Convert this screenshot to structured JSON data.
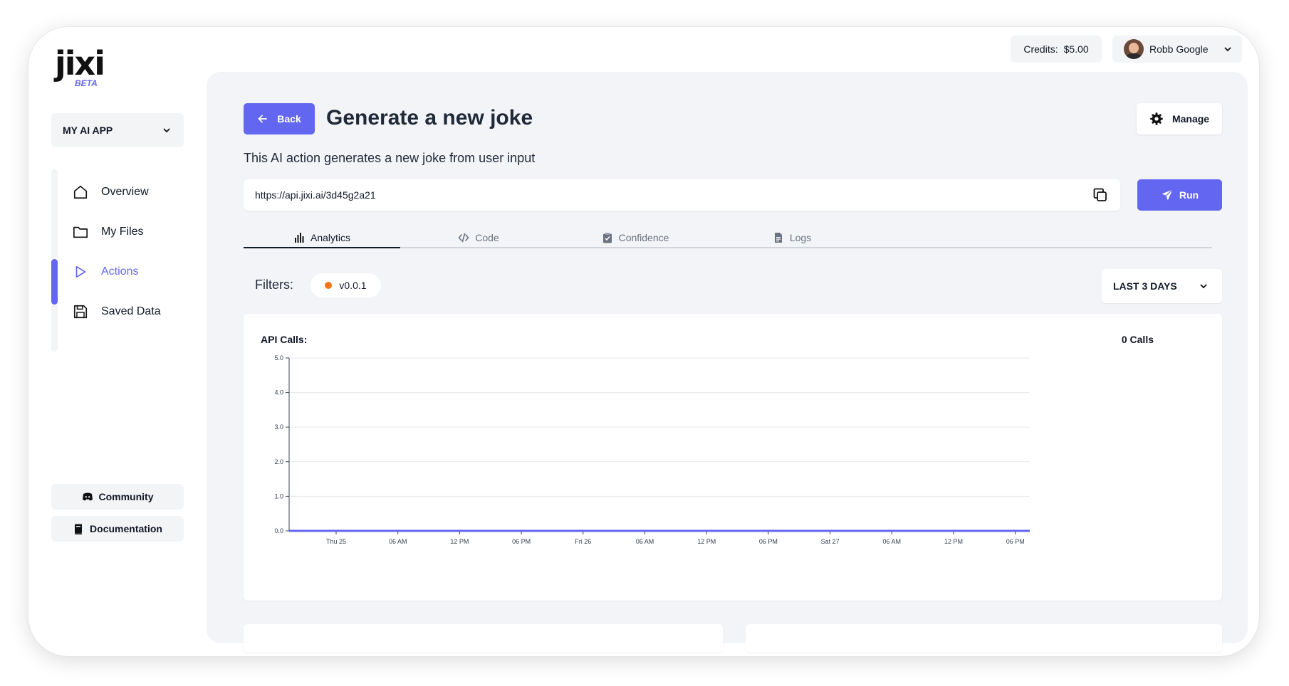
{
  "brand": {
    "logo": "jixi",
    "badge": "BETA"
  },
  "sidebar": {
    "app_select": "MY AI APP",
    "items": [
      {
        "label": "Overview",
        "icon": "home-icon"
      },
      {
        "label": "My Files",
        "icon": "folder-icon"
      },
      {
        "label": "Actions",
        "icon": "play-icon",
        "active": true
      },
      {
        "label": "Saved Data",
        "icon": "save-icon"
      }
    ],
    "community": "Community",
    "documentation": "Documentation"
  },
  "topbar": {
    "credits_label": "Credits:",
    "credits_value": "$5.00",
    "user_name": "Robb Google"
  },
  "header": {
    "back_label": "Back",
    "title": "Generate a new joke",
    "manage_label": "Manage",
    "description": "This AI action generates a new joke from user input"
  },
  "endpoint": {
    "url": "https://api.jixi.ai/3d45g2a21",
    "run_label": "Run"
  },
  "tabs": [
    {
      "label": "Analytics",
      "icon": "bar-chart-icon",
      "active": true
    },
    {
      "label": "Code",
      "icon": "code-icon"
    },
    {
      "label": "Confidence",
      "icon": "clipboard-icon"
    },
    {
      "label": "Logs",
      "icon": "document-icon"
    }
  ],
  "filters": {
    "label": "Filters:",
    "chip": "v0.0.1",
    "range": "LAST 3 DAYS"
  },
  "colors": {
    "accent": "#6366f1",
    "chip_dot": "#f97316"
  },
  "chart_data": {
    "type": "line",
    "title": "API Calls:",
    "summary": "0 Calls",
    "ylim": [
      0,
      5
    ],
    "y_ticks": [
      "5.0",
      "4.0",
      "3.0",
      "2.0",
      "1.0",
      "0.0"
    ],
    "x_ticks": [
      "Thu 25",
      "06 AM",
      "12 PM",
      "06 PM",
      "Fri 26",
      "06 AM",
      "12 PM",
      "06 PM",
      "Sat 27",
      "06 AM",
      "12 PM",
      "06 PM"
    ],
    "series": [
      {
        "values": [
          0,
          0,
          0,
          0,
          0,
          0,
          0,
          0,
          0,
          0,
          0,
          0
        ]
      }
    ],
    "grid": true
  }
}
